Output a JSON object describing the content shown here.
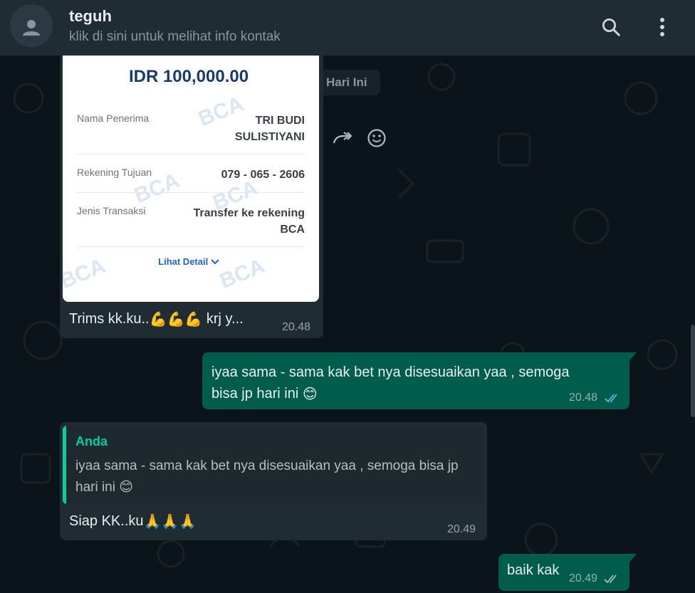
{
  "header": {
    "contact_name": "teguh",
    "subtitle": "klik di sini untuk melihat info kontak",
    "search_icon": "search-icon",
    "menu_icon": "kebab-menu-icon"
  },
  "date_chip": "Hari Ini",
  "receipt": {
    "amount": "IDR 100,000.00",
    "rows": [
      {
        "label": "Nama Penerima",
        "value_line1": "TRI BUDI",
        "value_line2": "SULISTIYANI"
      },
      {
        "label": "Rekening Tujuan",
        "value_line1": "079 - 065 - 2606",
        "value_line2": ""
      },
      {
        "label": "Jenis Transaksi",
        "value_line1": "Transfer ke rekening",
        "value_line2": "BCA"
      }
    ],
    "detail_link": "Lihat Detail",
    "watermark": "BCA"
  },
  "messages": [
    {
      "id": "m1",
      "direction": "in",
      "text": "Trims kk.ku..",
      "emoji": "💪💪💪",
      "text_after": "krj y...",
      "time": "20.48"
    },
    {
      "id": "m2",
      "direction": "out",
      "line1": "iyaa sama - sama kak bet nya disesuaikan yaa , semoga",
      "line2": "bisa jp hari ini",
      "emoji": "😊",
      "time": "20.48",
      "status": "read"
    },
    {
      "id": "m3",
      "direction": "in",
      "quote_author": "Anda",
      "quote_line1": "iyaa sama - sama kak bet nya disesuaikan yaa , semoga bisa jp",
      "quote_line2": "hari ini",
      "quote_emoji": "😊",
      "text": "Siap KK..ku",
      "emoji": "🙏🙏🙏",
      "time": "20.49"
    },
    {
      "id": "m4",
      "direction": "out",
      "text": "baik kak",
      "time": "20.49",
      "status": "delivered"
    }
  ],
  "colors": {
    "chat_bg": "#0b141a",
    "header_bg": "#202c33",
    "incoming": "#202c33",
    "outgoing": "#005c4b",
    "read_ticks": "#53bdeb",
    "accent": "#06cf9c"
  }
}
